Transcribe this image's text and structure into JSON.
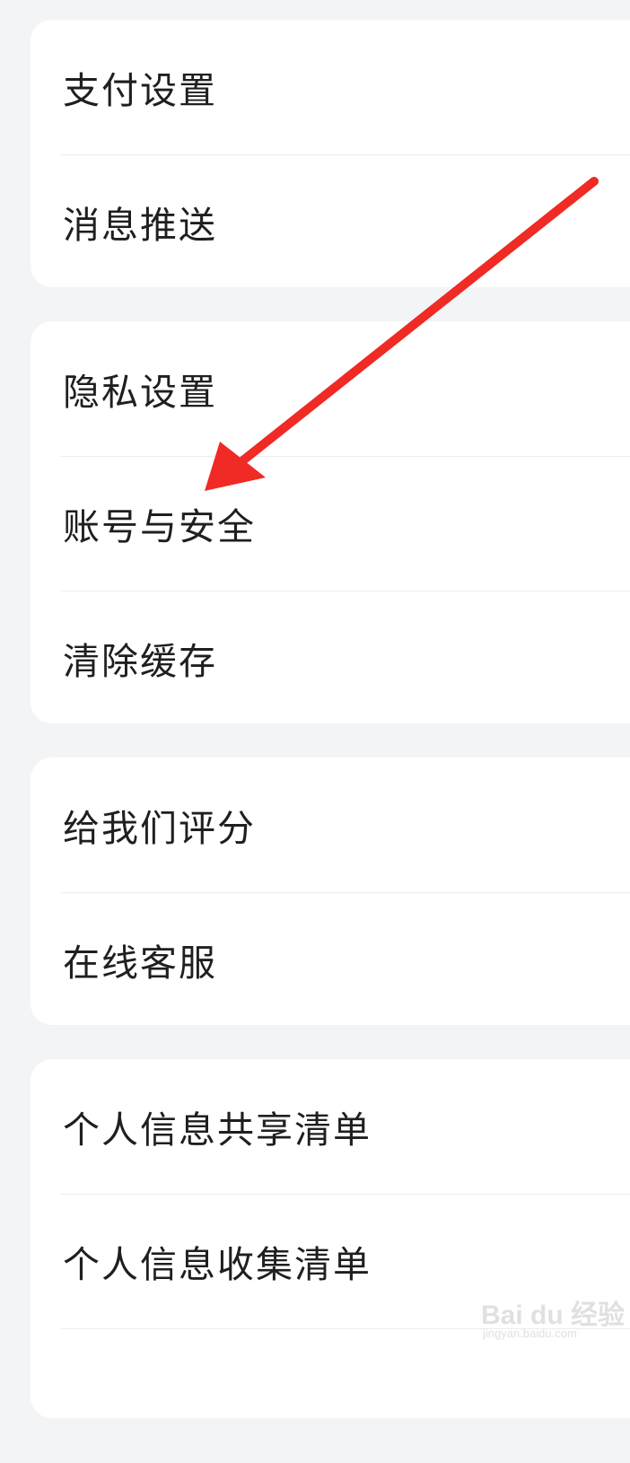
{
  "groups": [
    {
      "items": [
        {
          "label": "支付设置"
        },
        {
          "label": "消息推送"
        }
      ]
    },
    {
      "items": [
        {
          "label": "隐私设置"
        },
        {
          "label": "账号与安全"
        },
        {
          "label": "清除缓存"
        }
      ]
    },
    {
      "items": [
        {
          "label": "给我们评分"
        },
        {
          "label": "在线客服"
        }
      ]
    },
    {
      "items": [
        {
          "label": "个人信息共享清单"
        },
        {
          "label": "个人信息收集清单"
        }
      ]
    }
  ],
  "annotation": {
    "color": "#f02a24",
    "points_to": "账号与安全"
  },
  "watermark": {
    "logo": "Bai du 经验",
    "url": "jingyan.baidu.com"
  }
}
